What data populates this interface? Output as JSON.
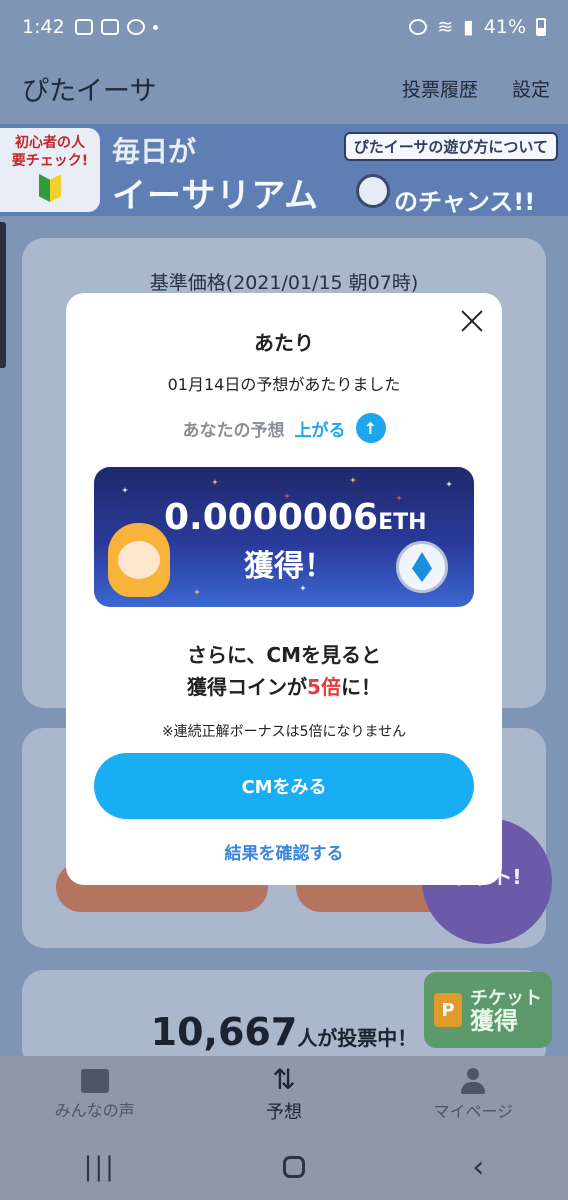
{
  "status": {
    "time": "1:42",
    "battery": "41%"
  },
  "appbar": {
    "title": "ぴたイーサ",
    "history": "投票履歴",
    "settings": "設定"
  },
  "banner": {
    "beginner_line1": "初心者の人",
    "beginner_line2": "要チェック!",
    "line1": "毎日が",
    "line2": "イーサリアム",
    "line3": "のチャンス!!",
    "howto": "ぴたイーサの遊び方について"
  },
  "background": {
    "base_price": "基準価格(2021/01/15 朝07時)",
    "votes_count": "10,667",
    "votes_suffix": "人が投票中！",
    "promo": "ゲット!",
    "ticket_label": "チケット",
    "ticket_get": "獲得"
  },
  "modal": {
    "title": "あたり",
    "result_line": "01月14日の予想があたりました",
    "prediction_label": "あなたの予想",
    "prediction_value": "上がる",
    "amount": "0.0000006",
    "amount_unit": "ETH",
    "acquired": "獲得！",
    "msg_line1": "さらに、CMを見ると",
    "msg_line2_pre": "獲得コインが",
    "msg_line2_highlight": "5倍",
    "msg_line2_post": "に！",
    "note": "※連続正解ボーナスは5倍になりません",
    "cm_button": "CMをみる",
    "confirm_link": "結果を確認する"
  },
  "bottom_nav": [
    {
      "label": "みんなの声",
      "icon": "chat-icon"
    },
    {
      "label": "予想",
      "icon": "swap-arrows-icon"
    },
    {
      "label": "マイページ",
      "icon": "person-icon"
    }
  ],
  "colors": {
    "accent": "#19aef3",
    "highlight": "#e53d3d",
    "link": "#3b86d8"
  }
}
